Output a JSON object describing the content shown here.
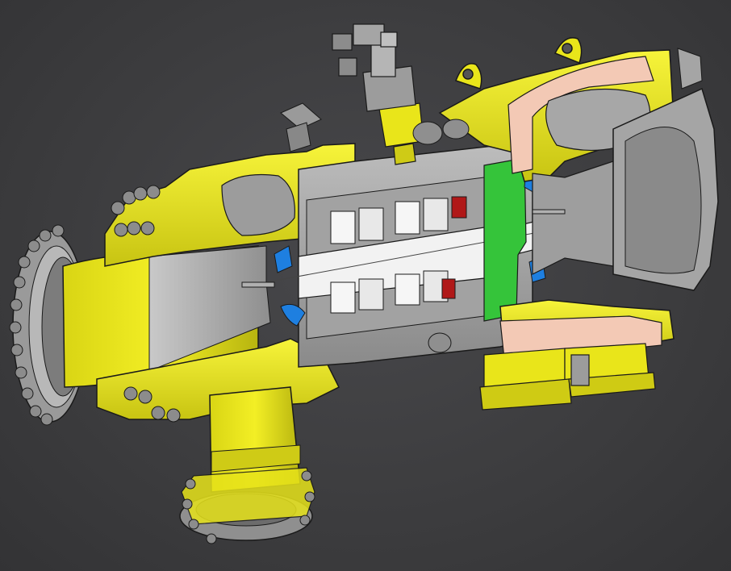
{
  "scene": {
    "background_color": "#3a3a3c",
    "colors": {
      "casing_yellow": "#f0ec1a",
      "casing_yellow_shade": "#c9c512",
      "metal_gray": "#a9a9a9",
      "metal_gray_dark": "#7d7d7d",
      "shaft_white": "#f2f2f2",
      "seal_green": "#35c43a",
      "seal_blue": "#1e7fe0",
      "accent_red": "#b01818",
      "volute_pink": "#f3c9b5",
      "outline": "#1a1a1a"
    }
  }
}
